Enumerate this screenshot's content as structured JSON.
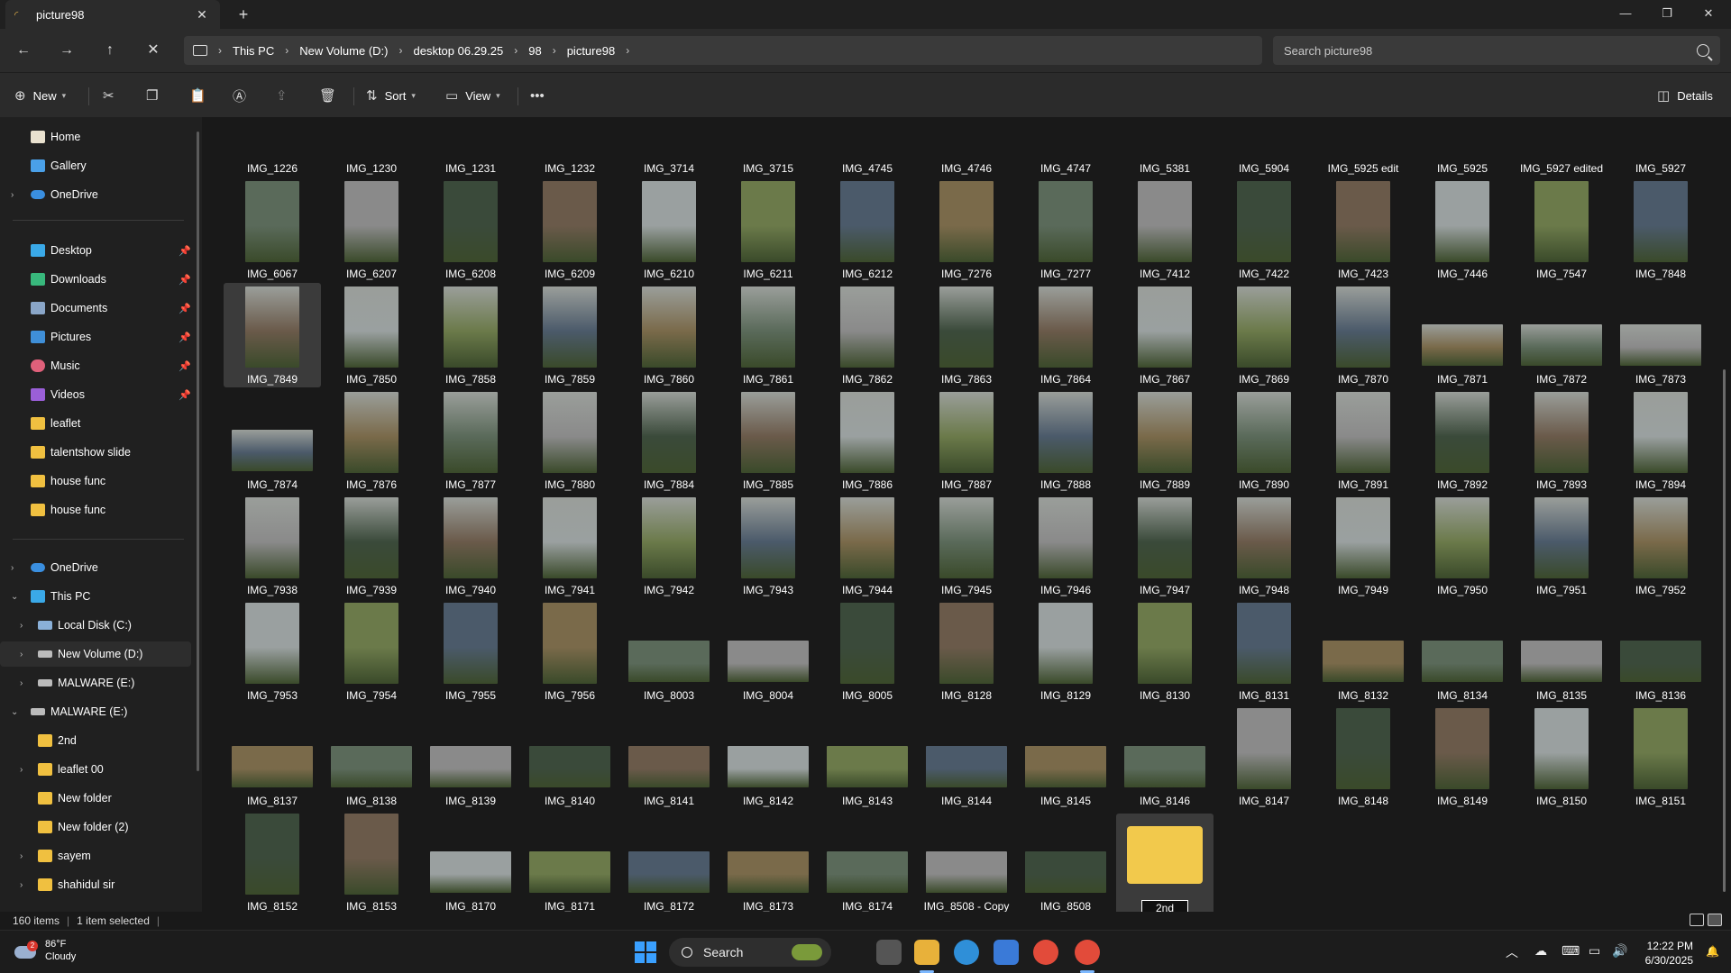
{
  "tab": {
    "title": "picture98"
  },
  "address": {
    "crumbs": [
      "This PC",
      "New Volume (D:)",
      "desktop 06.29.25",
      "98",
      "picture98"
    ]
  },
  "search": {
    "placeholder": "Search picture98"
  },
  "commands": {
    "new": "New",
    "sort": "Sort",
    "view": "View",
    "details": "Details"
  },
  "sidebar": {
    "home": "Home",
    "gallery": "Gallery",
    "onedrive_top": "OneDrive",
    "desktop": "Desktop",
    "downloads": "Downloads",
    "documents": "Documents",
    "pictures": "Pictures",
    "music": "Music",
    "videos": "Videos",
    "leaflet": "leaflet",
    "talentshow": "talentshow slide",
    "house1": "house func",
    "house2": "house func",
    "onedrive": "OneDrive",
    "thispc": "This PC",
    "localc": "Local Disk (C:)",
    "newvol": "New Volume (D:)",
    "malware1": "MALWARE (E:)",
    "malware2": "MALWARE (E:)",
    "f2nd": "2nd",
    "leaflet00": "leaflet 00",
    "newfolder": "New folder",
    "newfolder2": "New folder (2)",
    "sayem": "sayem",
    "shahidul": "shahidul sir"
  },
  "files": [
    [
      "IMG_1226",
      "IMG_1230",
      "IMG_1231",
      "IMG_1232",
      "IMG_3714",
      "IMG_3715",
      "IMG_4745",
      "IMG_4746",
      "IMG_4747",
      "IMG_5381",
      "IMG_5904",
      "IMG_5925 edit",
      "IMG_5925",
      "IMG_5927 edited",
      "IMG_5927"
    ],
    [
      "IMG_6067",
      "IMG_6207",
      "IMG_6208",
      "IMG_6209",
      "IMG_6210",
      "IMG_6211",
      "IMG_6212",
      "IMG_7276",
      "IMG_7277",
      "IMG_7412",
      "IMG_7422",
      "IMG_7423",
      "IMG_7446",
      "IMG_7547",
      "IMG_7848"
    ],
    [
      "IMG_7849",
      "IMG_7850",
      "IMG_7858",
      "IMG_7859",
      "IMG_7860",
      "IMG_7861",
      "IMG_7862",
      "IMG_7863",
      "IMG_7864",
      "IMG_7867",
      "IMG_7869",
      "IMG_7870",
      "IMG_7871",
      "IMG_7872",
      "IMG_7873"
    ],
    [
      "IMG_7874",
      "IMG_7876",
      "IMG_7877",
      "IMG_7880",
      "IMG_7884",
      "IMG_7885",
      "IMG_7886",
      "IMG_7887",
      "IMG_7888",
      "IMG_7889",
      "IMG_7890",
      "IMG_7891",
      "IMG_7892",
      "IMG_7893",
      "IMG_7894"
    ],
    [
      "IMG_7938",
      "IMG_7939",
      "IMG_7940",
      "IMG_7941",
      "IMG_7942",
      "IMG_7943",
      "IMG_7944",
      "IMG_7945",
      "IMG_7946",
      "IMG_7947",
      "IMG_7948",
      "IMG_7949",
      "IMG_7950",
      "IMG_7951",
      "IMG_7952"
    ],
    [
      "IMG_7953",
      "IMG_7954",
      "IMG_7955",
      "IMG_7956",
      "IMG_8003",
      "IMG_8004",
      "IMG_8005",
      "IMG_8128",
      "IMG_8129",
      "IMG_8130",
      "IMG_8131",
      "IMG_8132",
      "IMG_8134",
      "IMG_8135",
      "IMG_8136"
    ],
    [
      "IMG_8137",
      "IMG_8138",
      "IMG_8139",
      "IMG_8140",
      "IMG_8141",
      "IMG_8142",
      "IMG_8143",
      "IMG_8144",
      "IMG_8145",
      "IMG_8146",
      "IMG_8147",
      "IMG_8148",
      "IMG_8149",
      "IMG_8150",
      "IMG_8151"
    ],
    [
      "IMG_8152",
      "IMG_8153",
      "IMG_8170",
      "IMG_8171",
      "IMG_8172",
      "IMG_8173",
      "IMG_8174",
      "IMG_8508 - Copy",
      "IMG_8508"
    ]
  ],
  "rename_value": "2nd",
  "status": {
    "items": "160 items",
    "selected": "1 item selected"
  },
  "taskbar": {
    "temp": "86°F",
    "condition": "Cloudy",
    "badge": "2",
    "search": "Search",
    "time": "12:22 PM",
    "date": "6/30/2025"
  }
}
